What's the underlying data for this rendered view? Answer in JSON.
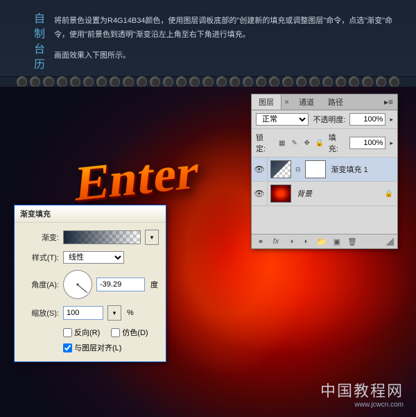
{
  "header": {
    "side_title": "自制台历",
    "line1": "将前景色设置为R4G14B34颜色，使用图层调板底部的\"创建新的填充或调整图层\"命令，点选\"渐变\"命令，使用\"前景色到透明\"渐变沿左上角至右下角进行填充。",
    "line2": "画面效果入下图所示。"
  },
  "canvas": {
    "text3d": "Enter",
    "watermark_cn": "中国教程网",
    "watermark_url": "www.jcwcn.com"
  },
  "layers_panel": {
    "tabs": {
      "layers": "图层",
      "channels": "通道",
      "paths": "路径",
      "close": "×"
    },
    "blend_mode": "正常",
    "opacity_label": "不透明度:",
    "opacity_value": "100%",
    "lock_label": "锁定:",
    "fill_label": "填充:",
    "fill_value": "100%",
    "layer1_name": "渐变填充 1",
    "layer2_name": "背景",
    "footer": {
      "fx": "fx"
    }
  },
  "gradient_dialog": {
    "title": "渐变填充",
    "gradient_label": "渐变:",
    "style_label": "样式(T):",
    "style_value": "线性",
    "angle_label": "角度(A):",
    "angle_value": "-39.29",
    "angle_unit": "度",
    "scale_label": "缩放(S):",
    "scale_value": "100",
    "scale_unit": "%",
    "reverse_label": "反向(R)",
    "dither_label": "仿色(D)",
    "align_label": "与图层对齐(L)"
  }
}
